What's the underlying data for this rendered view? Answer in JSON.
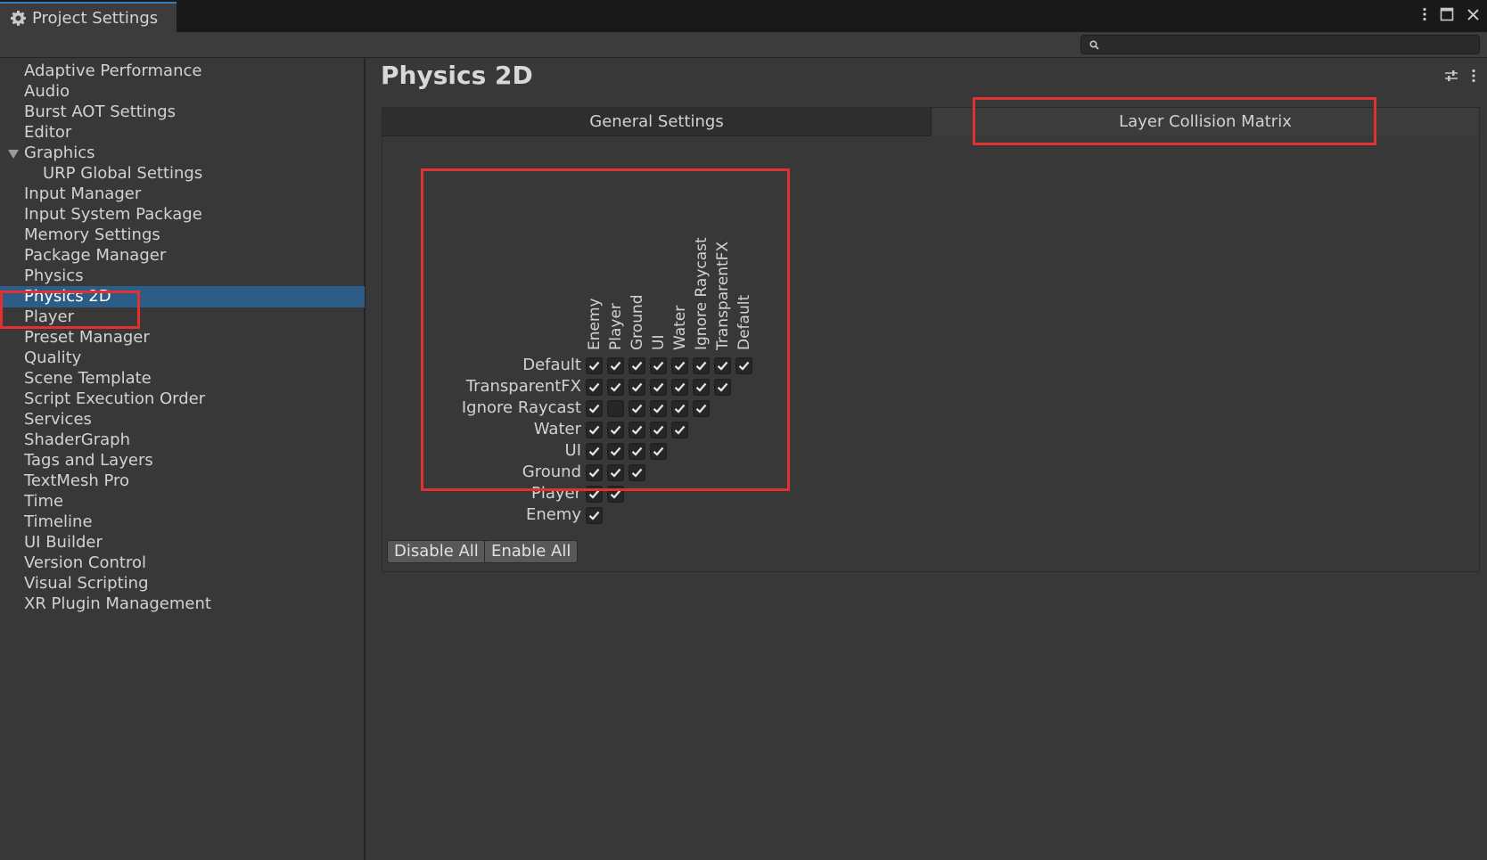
{
  "window": {
    "title": "Project Settings"
  },
  "search": {
    "placeholder": "",
    "value": ""
  },
  "sidebar": {
    "items": [
      {
        "label": "Adaptive Performance"
      },
      {
        "label": "Audio"
      },
      {
        "label": "Burst AOT Settings"
      },
      {
        "label": "Editor"
      },
      {
        "label": "Graphics",
        "expanded": true
      },
      {
        "label": "URP Global Settings",
        "child": true
      },
      {
        "label": "Input Manager"
      },
      {
        "label": "Input System Package"
      },
      {
        "label": "Memory Settings"
      },
      {
        "label": "Package Manager"
      },
      {
        "label": "Physics"
      },
      {
        "label": "Physics 2D",
        "selected": true
      },
      {
        "label": "Player"
      },
      {
        "label": "Preset Manager"
      },
      {
        "label": "Quality"
      },
      {
        "label": "Scene Template"
      },
      {
        "label": "Script Execution Order"
      },
      {
        "label": "Services"
      },
      {
        "label": "ShaderGraph"
      },
      {
        "label": "Tags and Layers"
      },
      {
        "label": "TextMesh Pro"
      },
      {
        "label": "Time"
      },
      {
        "label": "Timeline"
      },
      {
        "label": "UI Builder"
      },
      {
        "label": "Version Control"
      },
      {
        "label": "Visual Scripting"
      },
      {
        "label": "XR Plugin Management"
      }
    ]
  },
  "main": {
    "title": "Physics 2D",
    "tabs": [
      {
        "label": "General Settings",
        "active": false
      },
      {
        "label": "Layer Collision Matrix",
        "active": true
      }
    ],
    "matrix": {
      "columns": [
        "Default",
        "TransparentFX",
        "Ignore Raycast",
        "Water",
        "UI",
        "Ground",
        "Player",
        "Enemy"
      ],
      "rows": [
        "Default",
        "TransparentFX",
        "Ignore Raycast",
        "Water",
        "UI",
        "Ground",
        "Player",
        "Enemy"
      ],
      "unchecked": [
        [
          "Ignore Raycast",
          "Player"
        ]
      ]
    },
    "buttons": {
      "disable_all": "Disable All",
      "enable_all": "Enable All"
    }
  },
  "colors": {
    "accent": "#2c5d87",
    "highlight": "#e03030"
  }
}
